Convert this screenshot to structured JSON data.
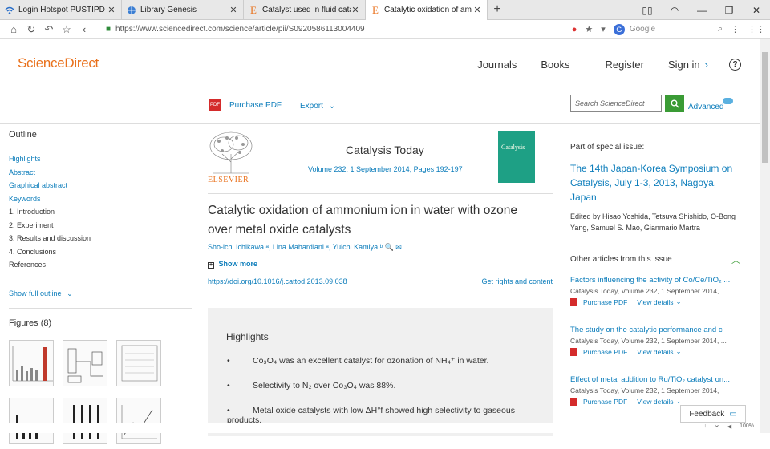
{
  "browser": {
    "tabs": [
      {
        "title": "Login Hotspot PUSTIPD",
        "icon": "wifi-icon",
        "active": false
      },
      {
        "title": "Library Genesis",
        "icon": "globe-icon",
        "active": false
      },
      {
        "title": "Catalyst used in fluid catalytic",
        "icon": "elsevier-icon",
        "active": false
      },
      {
        "title": "Catalytic oxidation of ammoni",
        "icon": "elsevier-icon",
        "active": true
      }
    ],
    "url": "https://www.sciencedirect.com/science/article/pii/S0920586113004409",
    "search_placeholder": "Google",
    "zoom": "100%"
  },
  "site": {
    "logo": "ScienceDirect",
    "nav": {
      "journals": "Journals",
      "books": "Books",
      "register": "Register",
      "signin": "Sign in"
    },
    "toolbar": {
      "purchase_pdf": "Purchase PDF",
      "export": "Export",
      "search_placeholder": "Search ScienceDirect",
      "advanced": "Advanced"
    }
  },
  "outline": {
    "title": "Outline",
    "items": [
      {
        "label": "Highlights",
        "link": true
      },
      {
        "label": "Abstract",
        "link": true
      },
      {
        "label": "Graphical abstract",
        "link": true
      },
      {
        "label": "Keywords",
        "link": true
      },
      {
        "label": "1. Introduction",
        "link": false
      },
      {
        "label": "2. Experiment",
        "link": false
      },
      {
        "label": "3. Results and discussion",
        "link": false
      },
      {
        "label": "4. Conclusions",
        "link": false
      },
      {
        "label": "References",
        "link": false
      }
    ],
    "show_full": "Show full outline",
    "figures_title": "Figures (8)"
  },
  "article": {
    "publisher": "ELSEVIER",
    "journal": "Catalysis Today",
    "volume": "Volume 232, 1 September 2014, Pages 192-197",
    "title": "Catalytic oxidation of ammonium ion in water with ozone over metal oxide catalysts",
    "authors": "Sho-ichi Ichikawa ᵃ, Lina Mahardiani ᵃ, Yuichi Kamiya ᵇ 🔍 ✉",
    "show_more": "Show more",
    "doi": "https://doi.org/10.1016/j.cattod.2013.09.038",
    "rights": "Get rights and content",
    "highlights_title": "Highlights",
    "highlights": [
      "Co₃O₄ was an excellent catalyst for ozonation of NH₄⁺ in water.",
      "Selectivity to N₂ over Co₃O₄ was 88%.",
      "Metal oxide catalysts with low ΔH°f showed high selectivity to gaseous products."
    ],
    "cover_text": "Catalysis"
  },
  "sidebar": {
    "special_label": "Part of special issue:",
    "special_title": "The 14th Japan-Korea Symposium on Catalysis, July 1-3, 2013, Nagoya, Japan",
    "editors": "Edited by Hisao Yoshida, Tetsuya Shishido, O-Bong Yang, Samuel S. Mao, Gianmario Martra",
    "other_title": "Other articles from this issue",
    "related": [
      {
        "title": "Factors influencing the activity of Co/Ce/TiO₂ ...",
        "meta": "Catalysis Today, Volume 232, 1 September 2014, ...",
        "pdf": "Purchase PDF",
        "view": "View details"
      },
      {
        "title": "The study on the catalytic performance and c",
        "meta": "Catalysis Today, Volume 232, 1 September 2014, ...",
        "pdf": "Purchase PDF",
        "view": "View details"
      },
      {
        "title": "Effect of metal addition to Ru/TiO₂ catalyst on...",
        "meta": "Catalysis Today, Volume 232, 1 September 2014,",
        "pdf": "Purchase PDF",
        "view": "View details"
      }
    ]
  },
  "feedback": "Feedback"
}
